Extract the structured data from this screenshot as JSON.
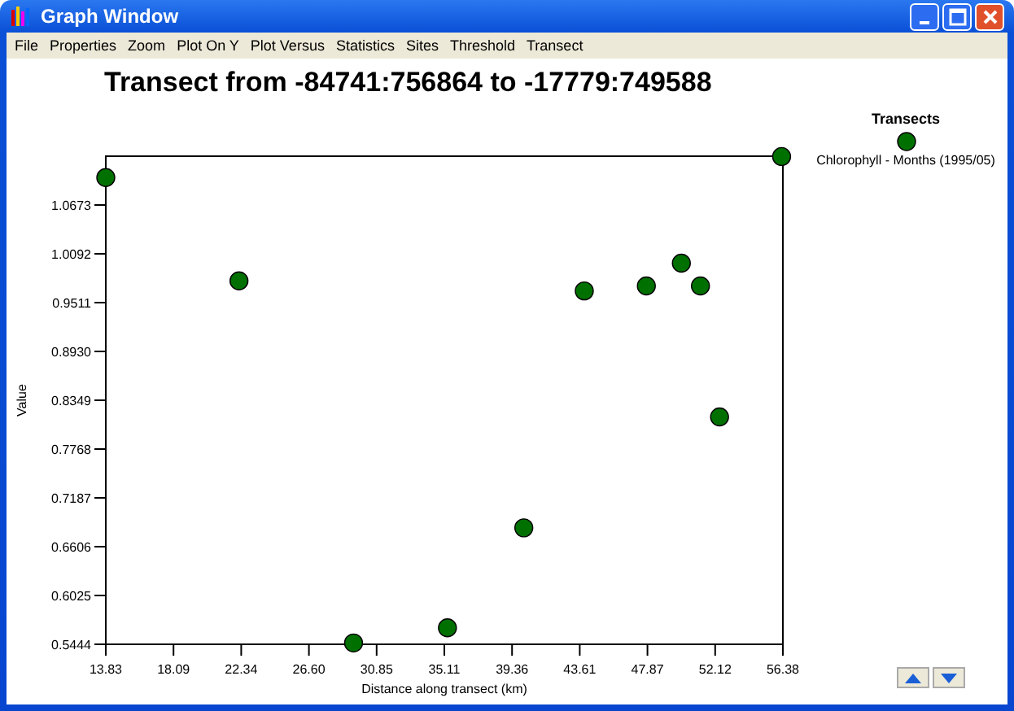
{
  "window": {
    "title": "Graph Window"
  },
  "menu": [
    "File",
    "Properties",
    "Zoom",
    "Plot On Y",
    "Plot Versus",
    "Statistics",
    "Sites",
    "Threshold",
    "Transect"
  ],
  "chart": {
    "chart_data": {
      "type": "scatter",
      "title": "Transect from -84741:756864 to -17779:749588",
      "xlabel": "Distance along transect (km)",
      "ylabel": "Value",
      "series": [
        {
          "name": "Chlorophyll - Months (1995/05)",
          "color": "#007000",
          "x": [
            13.83,
            22.2,
            29.4,
            35.3,
            40.1,
            43.9,
            47.8,
            50.0,
            51.2,
            52.4,
            56.3
          ],
          "values": [
            1.1,
            0.977,
            0.546,
            0.564,
            0.683,
            0.965,
            0.971,
            0.998,
            0.971,
            0.815,
            1.125
          ]
        }
      ],
      "xlim": [
        13.83,
        56.38
      ],
      "ylim": [
        0.5444,
        1.1254
      ],
      "xticks": [
        {
          "value": 13.83,
          "label": "13.83"
        },
        {
          "value": 18.085,
          "label": "18.09"
        },
        {
          "value": 22.34,
          "label": "22.34"
        },
        {
          "value": 26.595,
          "label": "26.60"
        },
        {
          "value": 30.85,
          "label": "30.85"
        },
        {
          "value": 35.105,
          "label": "35.11"
        },
        {
          "value": 39.36,
          "label": "39.36"
        },
        {
          "value": 43.615,
          "label": "43.61"
        },
        {
          "value": 47.87,
          "label": "47.87"
        },
        {
          "value": 52.125,
          "label": "52.12"
        },
        {
          "value": 56.38,
          "label": "56.38"
        }
      ],
      "yticks": [
        {
          "value": 0.5444,
          "label": "0.5444"
        },
        {
          "value": 0.6025,
          "label": "0.6025"
        },
        {
          "value": 0.6606,
          "label": "0.6606"
        },
        {
          "value": 0.7187,
          "label": "0.7187"
        },
        {
          "value": 0.7768,
          "label": "0.7768"
        },
        {
          "value": 0.8349,
          "label": "0.8349"
        },
        {
          "value": 0.893,
          "label": "0.8930"
        },
        {
          "value": 0.9511,
          "label": "0.9511"
        },
        {
          "value": 1.0092,
          "label": "1.0092"
        },
        {
          "value": 1.0673,
          "label": "1.0673"
        }
      ]
    }
  },
  "legend": {
    "title": "Transects"
  }
}
